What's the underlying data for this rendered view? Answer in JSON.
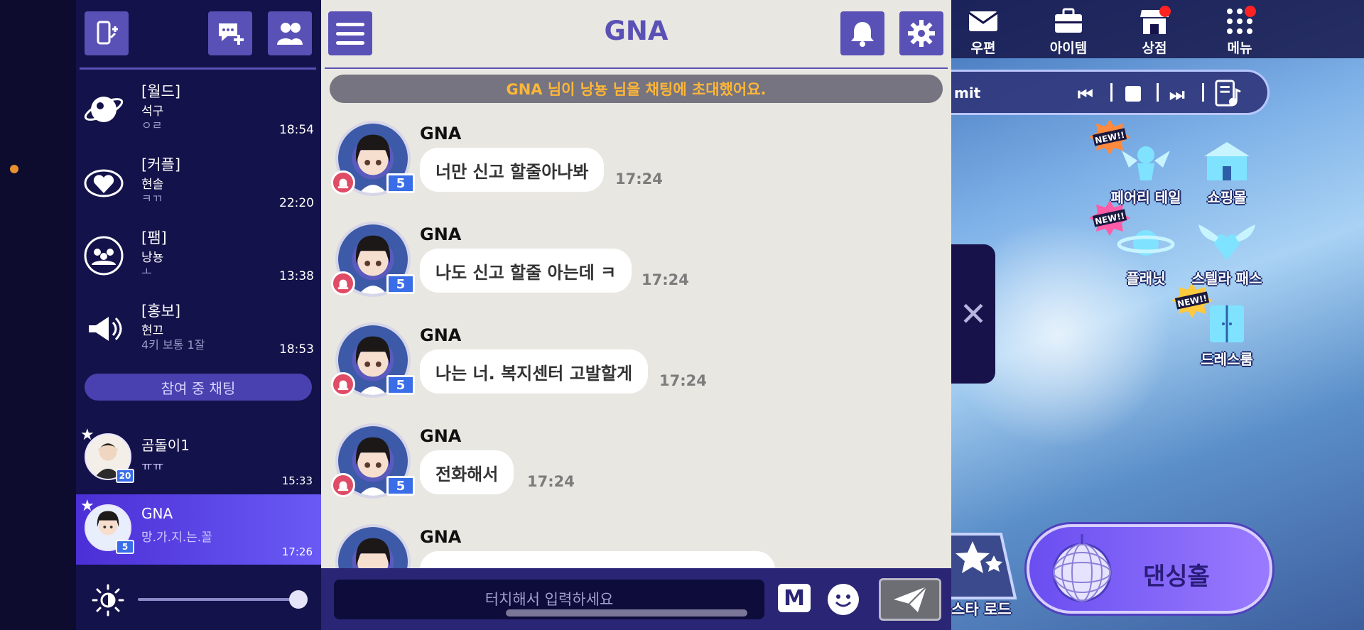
{
  "left": {
    "rooms": [
      {
        "category": "[월드]",
        "name": "석구",
        "preview": "ㅇㄹ",
        "time": "18:54",
        "icon": "world-icon"
      },
      {
        "category": "[커플]",
        "name": "현솔",
        "preview": "ㅋㄲ",
        "time": "22:20",
        "icon": "couple-heart-icon"
      },
      {
        "category": "[팸]",
        "name": "낭뇽",
        "preview": "ㅗ",
        "time": "13:38",
        "icon": "family-icon"
      },
      {
        "category": "[홍보]",
        "name": "현끄",
        "preview": "4키 보통 1잘",
        "time": "18:53",
        "icon": "megaphone-icon"
      }
    ],
    "joined_tab_label": "참여 중 채팅",
    "dms": [
      {
        "name": "곰돌이1",
        "preview": "ㅠㅠ",
        "time": "15:33",
        "level": "20"
      },
      {
        "name": "GNA",
        "preview": "망.가.지.는.꼴",
        "time": "17:26",
        "level": "5"
      }
    ]
  },
  "chat": {
    "title": "GNA",
    "system_message": "GNA 님이 낭뇽 님을 채팅에 초대했어요.",
    "messages": [
      {
        "sender": "GNA",
        "text": "너만 신고 할줄아나봐",
        "time": "17:24",
        "level": "5"
      },
      {
        "sender": "GNA",
        "text": "나도 신고 할줄 아는데 ㅋ",
        "time": "17:24",
        "level": "5"
      },
      {
        "sender": "GNA",
        "text": "나는 너. 복지센터 고발할게",
        "time": "17:24",
        "level": "5"
      },
      {
        "sender": "GNA",
        "text": "전화해서",
        "time": "17:24",
        "level": "5"
      },
      {
        "sender": "GNA",
        "text": "",
        "time": "",
        "level": ""
      }
    ],
    "input_placeholder": "터치해서 입력하세요",
    "m_button_label": "M"
  },
  "game": {
    "top_menu": [
      {
        "label": "우편",
        "icon": "mail-icon",
        "badge": false
      },
      {
        "label": "아이템",
        "icon": "briefcase-icon",
        "badge": false
      },
      {
        "label": "상점",
        "icon": "shop-icon",
        "badge": true
      },
      {
        "label": "메뉴",
        "icon": "grid-menu-icon",
        "badge": true
      }
    ],
    "music_title": "mit",
    "menus": [
      {
        "label": "페어리 테일",
        "new": true
      },
      {
        "label": "쇼핑몰",
        "new": false
      },
      {
        "label": "플래닛",
        "new": true
      },
      {
        "label": "스텔라 패스",
        "new": false
      },
      {
        "label": "드레스룸",
        "new": true
      }
    ],
    "new_badge_text": "NEW!!",
    "star_road_label": "스타 로드",
    "dance_hall_label": "댄싱홀"
  },
  "colors": {
    "accent": "#5a51b6",
    "system_text": "#ffb637",
    "active_dm": "#5b45e6"
  }
}
